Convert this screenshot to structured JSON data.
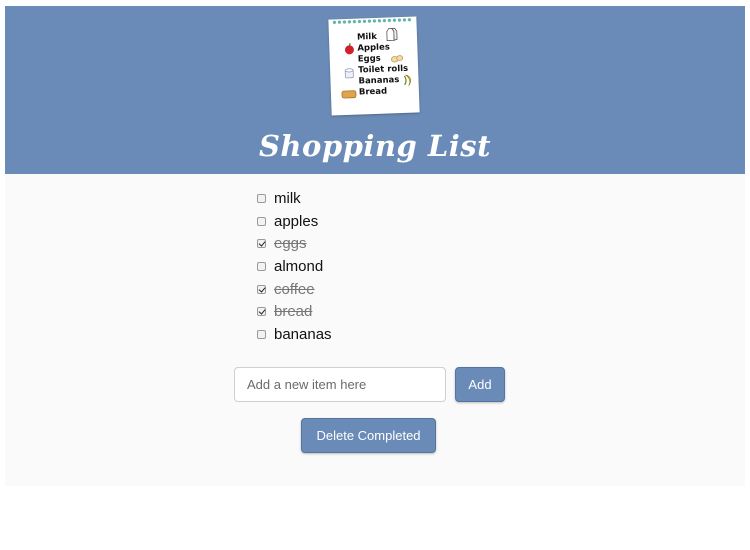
{
  "header": {
    "title": "Shopping List",
    "background_color": "#6a8bb7",
    "note_image": {
      "lines": [
        "Milk",
        "Apples",
        "Eggs",
        "Toilet rolls",
        "Bananas",
        "Bread"
      ],
      "icons": [
        "milk-carton-icon",
        "apple-icon",
        "eggs-icon",
        "toilet-roll-icon",
        "banana-icon",
        "bread-icon"
      ]
    }
  },
  "list": {
    "items": [
      {
        "label": "milk",
        "checked": false
      },
      {
        "label": "apples",
        "checked": false
      },
      {
        "label": "eggs",
        "checked": true
      },
      {
        "label": "almond",
        "checked": false
      },
      {
        "label": "coffee",
        "checked": true
      },
      {
        "label": "bread",
        "checked": true
      },
      {
        "label": "bananas",
        "checked": false
      }
    ]
  },
  "form": {
    "input_placeholder": "Add a new item here",
    "input_value": "",
    "add_label": "Add",
    "delete_label": "Delete Completed"
  },
  "colors": {
    "accent": "#6a8bb7",
    "page_background": "#fafafa"
  }
}
